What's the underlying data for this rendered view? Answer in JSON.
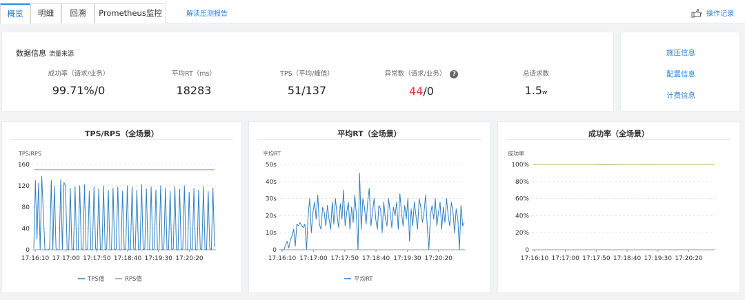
{
  "tabs": [
    {
      "label": "概览",
      "active": true
    },
    {
      "label": "明细",
      "active": false
    },
    {
      "label": "回溯",
      "active": false
    },
    {
      "label": "Prometheus监控",
      "active": false
    }
  ],
  "report_link": "解读压测报告",
  "op_log": "操作记录",
  "info": {
    "title": "数据信息",
    "subtitle": "流量来源",
    "metrics": [
      {
        "label": "成功率（请求/业务）",
        "value": "99.71%/0"
      },
      {
        "label": "平均RT（ms）",
        "value": "18283"
      },
      {
        "label": "TPS（平均/峰值）",
        "value": "51/137"
      },
      {
        "label": "异常数（请求/业务）",
        "value_red": "44",
        "value_rest": "/0",
        "help": "?"
      },
      {
        "label": "总请求数",
        "value": "1.5",
        "unit": "w"
      }
    ]
  },
  "side_links": [
    "施压信息",
    "配置信息",
    "计费信息"
  ],
  "charts": [
    {
      "title": "TPS/RPS（全场景）",
      "chart_data": {
        "type": "line",
        "ylabel": "TPS/RPS",
        "ylim": [
          0,
          160
        ],
        "yticks": [
          0,
          40,
          80,
          120,
          160
        ],
        "x_ticks": [
          "17:16:10",
          "17:17:00",
          "17:17:50",
          "17:18:40",
          "17:19:30",
          "17:20:20"
        ],
        "series": [
          {
            "name": "TPS值",
            "color": "#2f7fc4",
            "values": [
              2,
              130,
              20,
              125,
              0,
              138,
              70,
              0,
              0,
              0,
              2,
              130,
              0,
              118,
              2,
              0,
              0,
              132,
              0,
              126,
              120,
              0,
              0,
              115,
              2,
              0,
              118,
              0,
              0,
              120,
              2,
              0,
              122,
              0,
              2,
              110,
              0,
              0,
              118,
              2,
              0,
              115,
              0,
              0,
              120,
              0,
              2,
              112,
              0,
              0,
              116,
              0,
              2,
              118,
              0,
              0,
              110,
              0,
              2,
              120,
              0,
              0,
              118,
              2,
              0,
              112,
              0,
              0,
              122,
              0,
              2,
              115,
              0,
              0,
              118,
              0,
              2,
              112,
              0,
              0,
              120,
              0,
              2,
              116,
              0,
              0,
              110,
              0,
              2,
              118,
              0,
              0,
              114,
              0,
              2,
              120,
              0,
              0,
              108,
              2,
              0,
              115,
              0,
              0,
              112,
              2,
              0,
              118,
              0,
              0,
              110,
              2,
              0,
              116,
              5
            ]
          },
          {
            "name": "RPS值",
            "color": "#9a8fd8",
            "values": [
              150,
              150,
              150,
              150,
              150,
              150,
              150,
              150,
              150,
              150,
              150,
              150,
              150,
              150,
              150,
              150,
              150,
              150,
              150,
              150,
              150,
              150,
              150,
              150,
              150,
              150,
              150,
              150,
              150,
              150,
              150,
              150,
              150,
              150,
              150,
              150,
              150,
              150,
              150,
              150,
              150,
              150,
              150,
              150,
              150,
              150,
              150,
              150,
              150,
              150,
              150,
              150,
              150,
              150,
              150,
              150,
              150,
              150,
              150,
              150,
              150,
              150,
              150,
              150,
              150,
              150,
              150,
              150,
              150,
              150,
              150,
              150,
              150,
              150,
              150,
              150,
              150,
              150,
              150,
              150,
              150,
              150,
              150,
              150,
              150,
              150,
              150,
              150,
              150,
              150,
              150,
              150,
              150,
              150,
              150,
              150,
              150,
              150,
              150,
              150,
              150,
              150,
              150,
              150,
              150,
              150,
              150,
              150,
              150,
              150,
              150,
              150,
              150,
              150
            ]
          }
        ],
        "legend": "bottom"
      }
    },
    {
      "title": "平均RT（全场景）",
      "chart_data": {
        "type": "line",
        "ylabel": "平均RT",
        "ylim": [
          0,
          50
        ],
        "yticks": [
          "0",
          "10s",
          "20s",
          "30s",
          "40s",
          "50s"
        ],
        "x_ticks": [
          "17:16:10",
          "17:17:00",
          "17:17:50",
          "17:18:40",
          "17:19:30",
          "17:20:20"
        ],
        "series": [
          {
            "name": "平均RT",
            "color": "#2f7fc4",
            "values": [
              0,
              0,
              0,
              3,
              5,
              1,
              6,
              8,
              12,
              2,
              15,
              14,
              16,
              14,
              13,
              15,
              0,
              20,
              30,
              10,
              22,
              28,
              18,
              32,
              15,
              12,
              25,
              22,
              14,
              26,
              18,
              12,
              28,
              15,
              30,
              20,
              13,
              27,
              18,
              35,
              14,
              22,
              28,
              12,
              25,
              16,
              32,
              20,
              0,
              45,
              12,
              30,
              25,
              15,
              28,
              36,
              14,
              22,
              30,
              18,
              12,
              26,
              24,
              10,
              28,
              18,
              14,
              30,
              22,
              13,
              25,
              20,
              28,
              12,
              33,
              22,
              14,
              26,
              18,
              30,
              5,
              24,
              14,
              28,
              20,
              12,
              30,
              25,
              16,
              22,
              32,
              14,
              0,
              20,
              26,
              18,
              30,
              14,
              22,
              28,
              12,
              25,
              16,
              30,
              20,
              14,
              28,
              22,
              10,
              24,
              18,
              0,
              26,
              14,
              16
            ]
          }
        ],
        "legend": "bottom"
      }
    },
    {
      "title": "成功率（全场景）",
      "chart_data": {
        "type": "line",
        "ylabel": "成功率",
        "ylim": [
          0,
          100
        ],
        "yticks": [
          "0",
          "20%",
          "40%",
          "60%",
          "80%",
          "100%"
        ],
        "x_ticks": [
          "17:16:10",
          "17:17:00",
          "17:17:50",
          "17:18:40",
          "17:19:30",
          "17:20:20"
        ],
        "series": [
          {
            "name": "",
            "color": "#8bc36a",
            "values": [
              100,
              100,
              100,
              100,
              100,
              100,
              100,
              100,
              100,
              100,
              100,
              100,
              100,
              100,
              99.7,
              99.6,
              99.8,
              99.7,
              99.8,
              99.9,
              100,
              100,
              100,
              100,
              99.8,
              99.9,
              100,
              100,
              100,
              100,
              100,
              100,
              100,
              100,
              100,
              100,
              100,
              100,
              100,
              100
            ]
          }
        ],
        "legend": "none"
      }
    }
  ]
}
